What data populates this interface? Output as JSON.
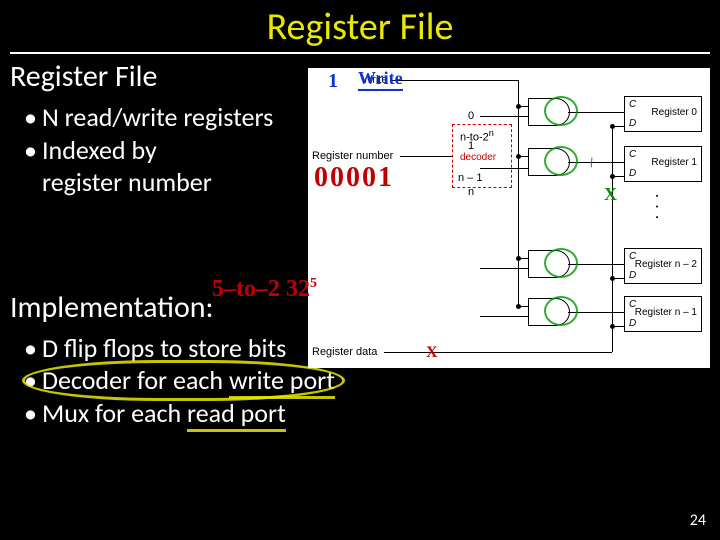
{
  "title": "Register File",
  "section1": "Register File",
  "bullets1": [
    "N read/write registers",
    "Indexed by register number"
  ],
  "bullets1_wrap": {
    "line1a": "N read/write registers",
    "line2a": "Indexed by",
    "line2b": "register number"
  },
  "section2": "Implementation:",
  "bullets2": {
    "a": "D flip flops to store bits",
    "b_pre": "Decoder for each ",
    "b_hl": "write port",
    "c_pre": "Mux for each ",
    "c_hl": "read port"
  },
  "page_number": "24",
  "diagram": {
    "write_label": "Write",
    "reg_number_label": "Register number",
    "reg_data_label": "Register data",
    "decoder_top": "n-to-2",
    "decoder_exp": "n",
    "decoder_word": "decoder",
    "indices": {
      "zero": "0",
      "one": "1",
      "nminus1": "n – 1",
      "n": "n"
    },
    "registers": {
      "r0": "Register 0",
      "r1": "Register 1",
      "r2": "Register n – 2",
      "r3": "Register n – 1"
    },
    "c": "C",
    "d": "D"
  },
  "annotations": {
    "one": "1",
    "write_hand": "Write",
    "binary": "00001",
    "five_to_32": "5–to–2  32",
    "five_exp": "5",
    "x": "X",
    "slash": "/"
  }
}
